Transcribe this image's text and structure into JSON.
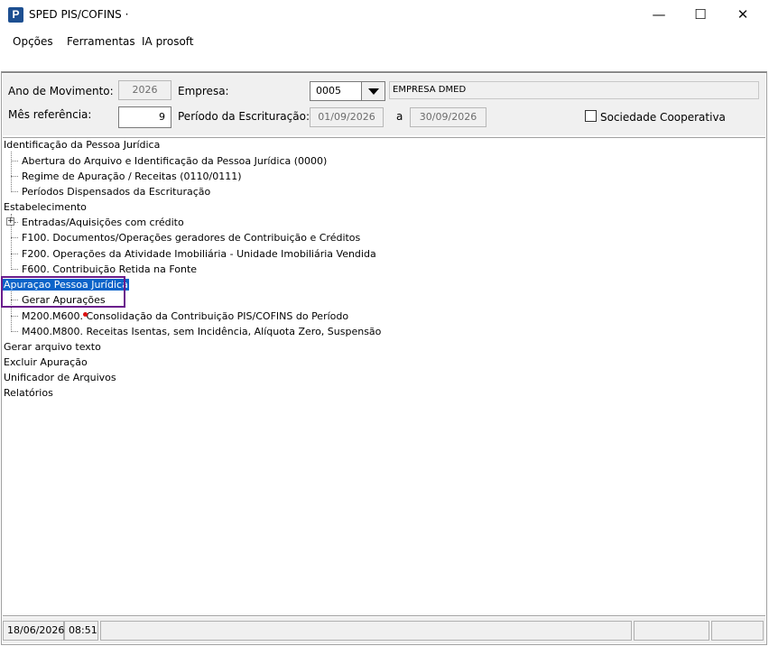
{
  "window": {
    "title": "SPED PIS/COFINS ·",
    "app_icon_letter": "P",
    "minimize": "—",
    "maximize": "☐",
    "close": "✕"
  },
  "menu": {
    "items": [
      "Opções",
      "Ferramentas",
      "IA prosoft"
    ]
  },
  "form": {
    "ano_label": "Ano de Movimento:",
    "ano_value": "2026",
    "empresa_label": "Empresa:",
    "empresa_code": "0005",
    "empresa_name": "EMPRESA DMED",
    "mes_label": "Mês referência:",
    "mes_value": "9",
    "periodo_label": "Período da Escrituração:",
    "periodo_inicio": "01/09/2026",
    "periodo_sep": "a",
    "periodo_fim": "30/09/2026",
    "coop_label": "Sociedade Cooperativa",
    "coop_checked": false
  },
  "tree": [
    "Identificação da Pessoa Jurídica",
    "Abertura do Arquivo e Identificação da Pessoa Jurídica (0000)",
    "Regime de Apuração / Receitas (0110/0111)",
    "Períodos Dispensados da Escrituração",
    "Estabelecimento",
    "Entradas/Aquisições com crédito",
    "F100. Documentos/Operações geradores de Contribuição e Créditos",
    "F200. Operações da Atividade Imobiliária - Unidade Imobiliária Vendida",
    "F600. Contribuição Retida na Fonte",
    "Apuraçao Pessoa Jurídica",
    "Gerar Apurações",
    "M200.M600. Consolidação da Contribuição PIS/COFINS do Período",
    "M400.M800. Receitas Isentas, sem Incidência, Alíquota Zero, Suspensão",
    "Gerar arquivo texto",
    "Excluir Apuração",
    "Unificador de Arquivos",
    "Relatórios"
  ],
  "tree_expander": "+",
  "status": {
    "date": "18/06/2026",
    "time": "08:51"
  }
}
